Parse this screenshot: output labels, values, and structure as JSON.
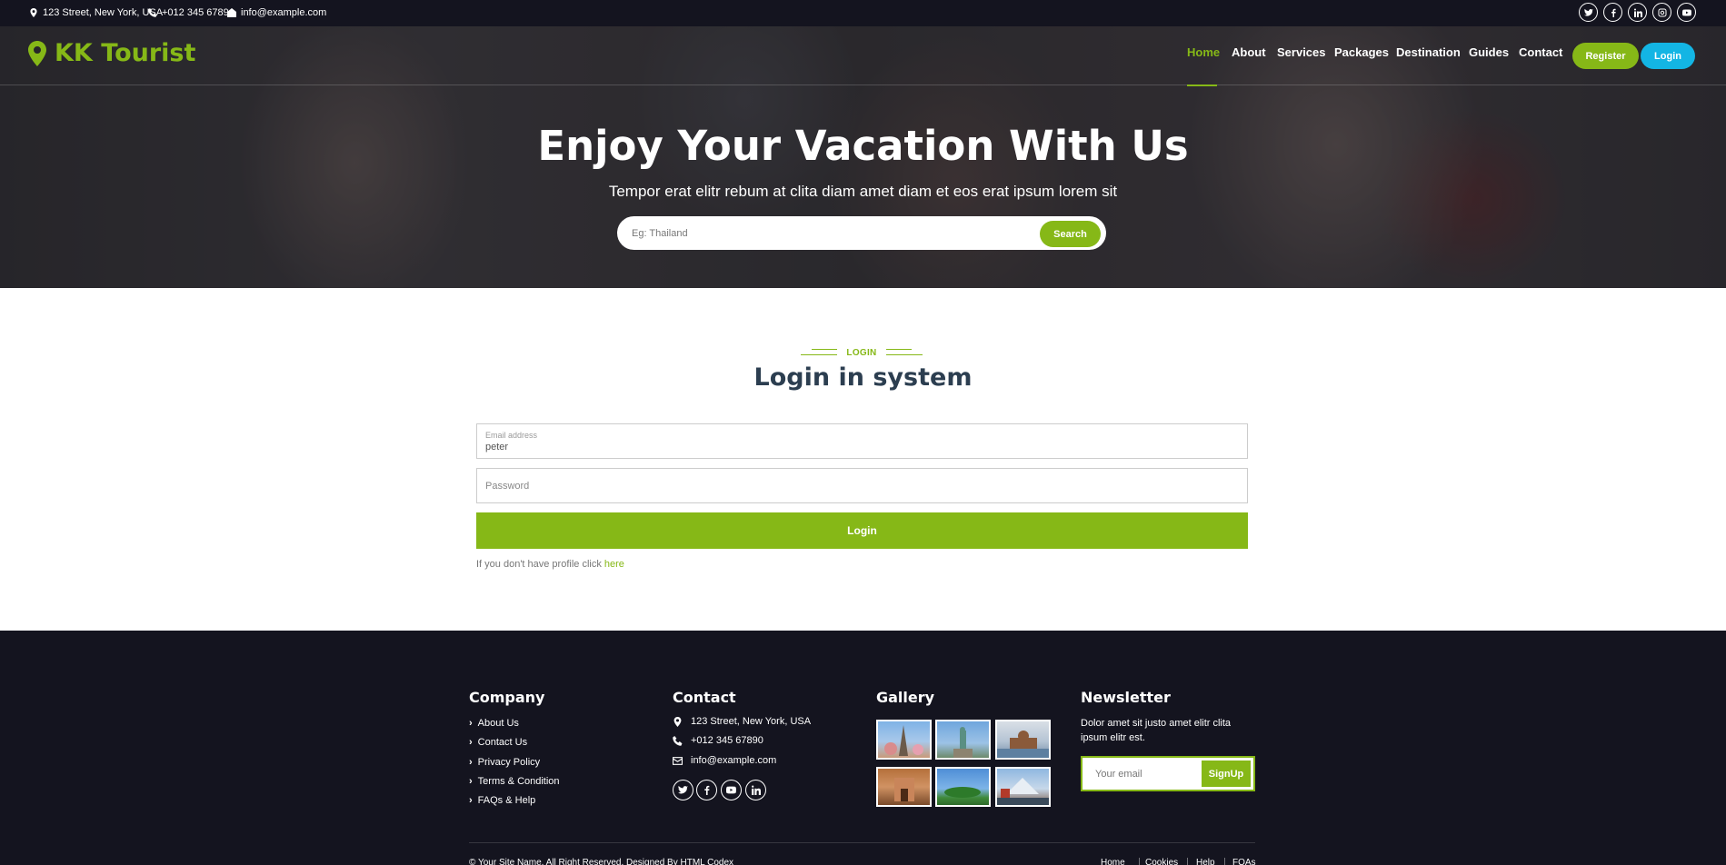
{
  "topbar": {
    "address": "123 Street, New York, USA",
    "phone": "+012 345 6789",
    "email": "info@example.com",
    "social": [
      "twitter-icon",
      "facebook-icon",
      "linkedin-icon",
      "instagram-icon",
      "youtube-icon"
    ]
  },
  "brand": {
    "name": "KK Tourist",
    "color": "#86b817"
  },
  "nav": {
    "items": [
      "Home",
      "About",
      "Services",
      "Packages",
      "Destination",
      "Guides",
      "Contact"
    ],
    "active": "Home",
    "register_label": "Register",
    "login_label": "Login"
  },
  "hero": {
    "title": "Enjoy Your Vacation With Us",
    "subtitle": "Tempor erat elitr rebum at clita diam amet diam et eos erat ipsum lorem sit",
    "search_placeholder": "Eg: Thailand",
    "search_button": "Search"
  },
  "login": {
    "tag": "LOGIN",
    "title": "Login in system",
    "email_label": "Email address",
    "email_value": "peter",
    "password_placeholder": "Password",
    "submit_label": "Login",
    "hint_text": "If you don't have profile click ",
    "hint_link": "here"
  },
  "footer": {
    "company_title": "Company",
    "company_links": [
      "About Us",
      "Contact Us",
      "Privacy Policy",
      "Terms & Condition",
      "FAQs & Help"
    ],
    "contact_title": "Contact",
    "contact_address": "123 Street, New York, USA",
    "contact_phone": "+012 345 67890",
    "contact_email": "info@example.com",
    "gallery_title": "Gallery",
    "newsletter_title": "Newsletter",
    "newsletter_text": "Dolor amet sit justo amet elitr clita ipsum elitr est.",
    "newsletter_placeholder": "Your email",
    "newsletter_button": "SignUp",
    "copyright": "© Your Site Name, All Right Reserved. Designed By HTML Codex",
    "bottom_links": [
      "Home",
      "Cookies",
      "Help",
      "FQAs"
    ]
  },
  "colors": {
    "accent": "#86b817",
    "login_blue": "#13b5e4",
    "dark": "#14141f"
  }
}
